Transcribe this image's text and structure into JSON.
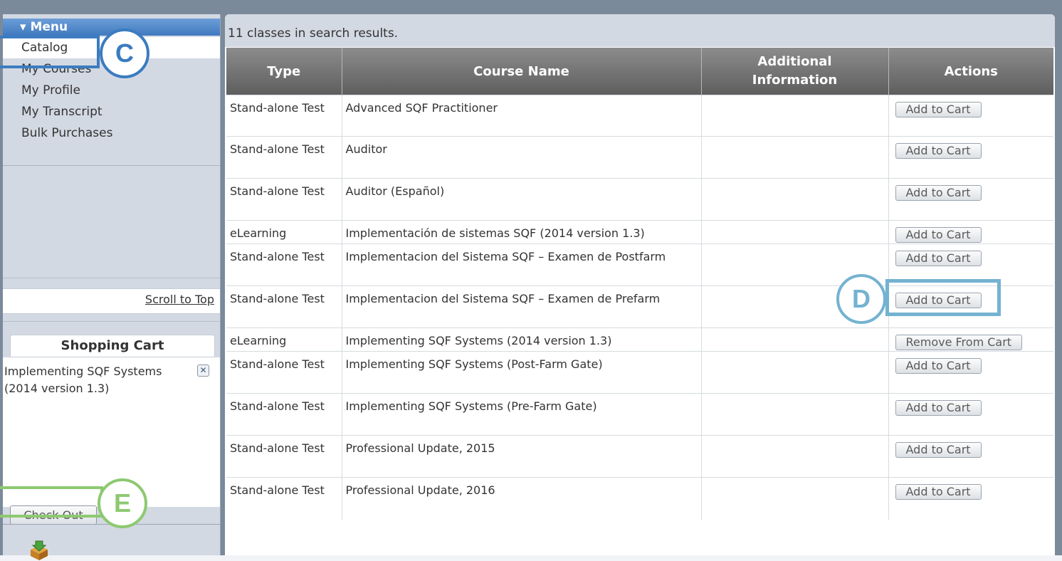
{
  "sidebar": {
    "menu_title": "▾ Menu",
    "items": [
      {
        "label": "Catalog"
      },
      {
        "label": "My Courses"
      },
      {
        "label": "My Profile"
      },
      {
        "label": "My Transcript"
      },
      {
        "label": "Bulk Purchases"
      }
    ],
    "scroll_to_top": "Scroll to Top",
    "cart": {
      "title": "Shopping Cart",
      "items": [
        {
          "name": "Implementing SQF Systems (2014 version 1.3)",
          "remove_icon": "close-x-icon"
        }
      ]
    },
    "checkout_label": "Check Out"
  },
  "main": {
    "results_text": "11 classes in search results.",
    "columns": [
      "Type",
      "Course Name",
      "Additional Information",
      "Actions"
    ],
    "rows": [
      {
        "type": "Stand-alone Test",
        "name": "Advanced SQF Practitioner",
        "info": "",
        "action": "Add to Cart"
      },
      {
        "type": "Stand-alone Test",
        "name": "Auditor",
        "info": "",
        "action": "Add to Cart"
      },
      {
        "type": "Stand-alone Test",
        "name": "Auditor (Español)",
        "info": "",
        "action": "Add to Cart"
      },
      {
        "type": "eLearning",
        "name": "Implementación de sistemas SQF (2014 version 1.3)",
        "info": "",
        "action": "Add to Cart"
      },
      {
        "type": "Stand-alone Test",
        "name": "Implementacion del Sistema SQF – Examen de Postfarm",
        "info": "",
        "action": "Add to Cart"
      },
      {
        "type": "Stand-alone Test",
        "name": "Implementacion del Sistema SQF – Examen de Prefarm",
        "info": "",
        "action": "Add to Cart"
      },
      {
        "type": "eLearning",
        "name": "Implementing SQF Systems (2014 version 1.3)",
        "info": "",
        "action": "Remove From Cart"
      },
      {
        "type": "Stand-alone Test",
        "name": "Implementing SQF Systems (Post-Farm Gate)",
        "info": "",
        "action": "Add to Cart"
      },
      {
        "type": "Stand-alone Test",
        "name": "Implementing SQF Systems (Pre-Farm Gate)",
        "info": "",
        "action": "Add to Cart"
      },
      {
        "type": "Stand-alone Test",
        "name": "Professional Update, 2015",
        "info": "",
        "action": "Add to Cart"
      },
      {
        "type": "Stand-alone Test",
        "name": "Professional Update, 2016",
        "info": "",
        "action": "Add to Cart"
      }
    ]
  },
  "callouts": {
    "c": {
      "label": "C",
      "color": "#3b7cc0"
    },
    "d": {
      "label": "D",
      "color": "#74b2d1"
    },
    "e": {
      "label": "E",
      "color": "#8dc971"
    }
  },
  "colors": {
    "menu_header": "#4a86c8",
    "table_header": "#6e6e6e"
  }
}
